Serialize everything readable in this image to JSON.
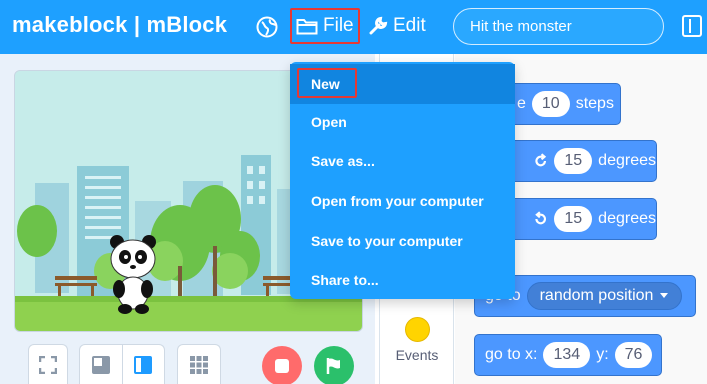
{
  "header": {
    "logo_text": "makeblock | mBlock",
    "file_label": "File",
    "edit_label": "Edit",
    "project_name": "Hit the monster"
  },
  "file_menu": {
    "items": [
      {
        "label": "New",
        "active": true
      },
      {
        "label": "Open"
      },
      {
        "label": "Save as..."
      },
      {
        "label": "Open from your computer"
      },
      {
        "label": "Save to your computer"
      },
      {
        "label": "Share to..."
      }
    ]
  },
  "categories": {
    "events_label": "Events",
    "events_color": "#ffd400"
  },
  "blocks": {
    "move_prefix": "e",
    "move_steps_value": "10",
    "move_suffix": "steps",
    "turn_right_value": "15",
    "turn_right_suffix": "degrees",
    "turn_left_value": "15",
    "turn_left_suffix": "degrees",
    "goto_label": "go to",
    "goto_option": "random position",
    "gotoxy_label": "go to x:",
    "gotoxy_x": "134",
    "gotoxy_y_label": "y:",
    "gotoxy_y": "76"
  },
  "colors": {
    "header": "#1ea0ff",
    "motion_block": "#4c97ff",
    "highlight_outline": "#e53935",
    "stop": "#ff6b6b",
    "go": "#2bc06b"
  },
  "icons": [
    "globe-icon",
    "folder-icon",
    "wrench-icon",
    "fullscreen-icon",
    "small-stage-icon",
    "large-stage-icon",
    "grid-icon",
    "stop-icon",
    "flag-icon",
    "rotate-right-icon",
    "rotate-left-icon",
    "dropdown-arrow-icon"
  ]
}
